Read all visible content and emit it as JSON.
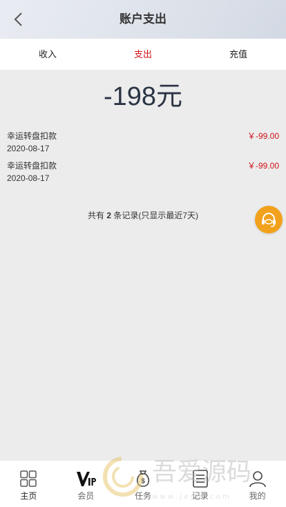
{
  "header": {
    "title": "账户支出"
  },
  "tabs": [
    {
      "label": "收入",
      "active": false
    },
    {
      "label": "支出",
      "active": true
    },
    {
      "label": "充值",
      "active": false
    }
  ],
  "total": {
    "amount": "-198元"
  },
  "records": [
    {
      "name": "幸运转盘扣款",
      "date": "2020-08-17",
      "amount": "￥-99.00"
    },
    {
      "name": "幸运转盘扣款",
      "date": "2020-08-17",
      "amount": "￥-99.00"
    }
  ],
  "summary": {
    "prefix": "共有",
    "count": "2",
    "suffix": "条记录(只显示最近7天)"
  },
  "bottom_nav": [
    {
      "label": "主页",
      "icon": "home-grid-icon",
      "active": true
    },
    {
      "label": "会员",
      "icon": "vip-icon",
      "active": false
    },
    {
      "label": "任务",
      "icon": "money-bag-icon",
      "active": false
    },
    {
      "label": "记录",
      "icon": "list-icon",
      "active": false
    },
    {
      "label": "我的",
      "icon": "user-icon",
      "active": false
    }
  ],
  "watermark": {
    "text": "吾爱源码",
    "sub": "w w w . j e y m . c o m"
  },
  "colors": {
    "accent_red": "#d0121b",
    "support_orange": "#f1a11b"
  }
}
